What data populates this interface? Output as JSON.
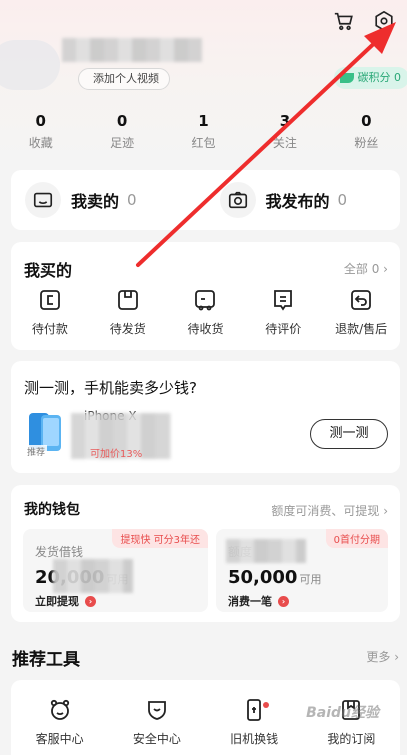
{
  "header": {
    "video_label": "添加个人视频",
    "carbon_label": "碳积分 0"
  },
  "stats": [
    {
      "value": "0",
      "label": "收藏"
    },
    {
      "value": "0",
      "label": "足迹"
    },
    {
      "value": "1",
      "label": "红包"
    },
    {
      "value": "3",
      "label": "关注"
    },
    {
      "value": "0",
      "label": "粉丝"
    }
  ],
  "sell": {
    "sold_label": "我卖的",
    "sold_count": "0",
    "published_label": "我发布的",
    "published_count": "0"
  },
  "bought": {
    "title": "我买的",
    "all_link": "全部 0 ›",
    "items": [
      {
        "label": "待付款",
        "icon": "wallet-icon"
      },
      {
        "label": "待发货",
        "icon": "package-icon"
      },
      {
        "label": "待收货",
        "icon": "truck-icon"
      },
      {
        "label": "待评价",
        "icon": "comment-icon"
      },
      {
        "label": "退款/售后",
        "icon": "refund-icon"
      }
    ]
  },
  "estimate": {
    "title": "测一测，手机能卖多少钱?",
    "phone_name": "iPhone X",
    "badge": "推荐",
    "increase": "可加价13%",
    "button": "测一测"
  },
  "wallet": {
    "title": "我的钱包",
    "link": "额度可消费、可提现 ›",
    "loan": {
      "label": "发货借钱",
      "amount": "20,000",
      "unit": "可用",
      "action": "立即提现",
      "tag": "提现快 可分3年还"
    },
    "credit": {
      "label": "额度",
      "amount": "50,000",
      "unit": "可用",
      "action": "消费一笔",
      "tag": "0首付分期"
    }
  },
  "tools": {
    "title": "推荐工具",
    "more": "更多 ›",
    "items": [
      {
        "label": "客服中心",
        "icon": "customer-service-icon"
      },
      {
        "label": "安全中心",
        "icon": "shield-icon"
      },
      {
        "label": "旧机换钱",
        "icon": "phone-exchange-icon"
      },
      {
        "label": "我的订阅",
        "icon": "bookmark-icon"
      }
    ]
  },
  "watermark": "Baidu经验",
  "colors": {
    "accent_red": "#e84c4c",
    "carbon_green": "#2aa877",
    "arrow_red": "#ee2d2d"
  }
}
